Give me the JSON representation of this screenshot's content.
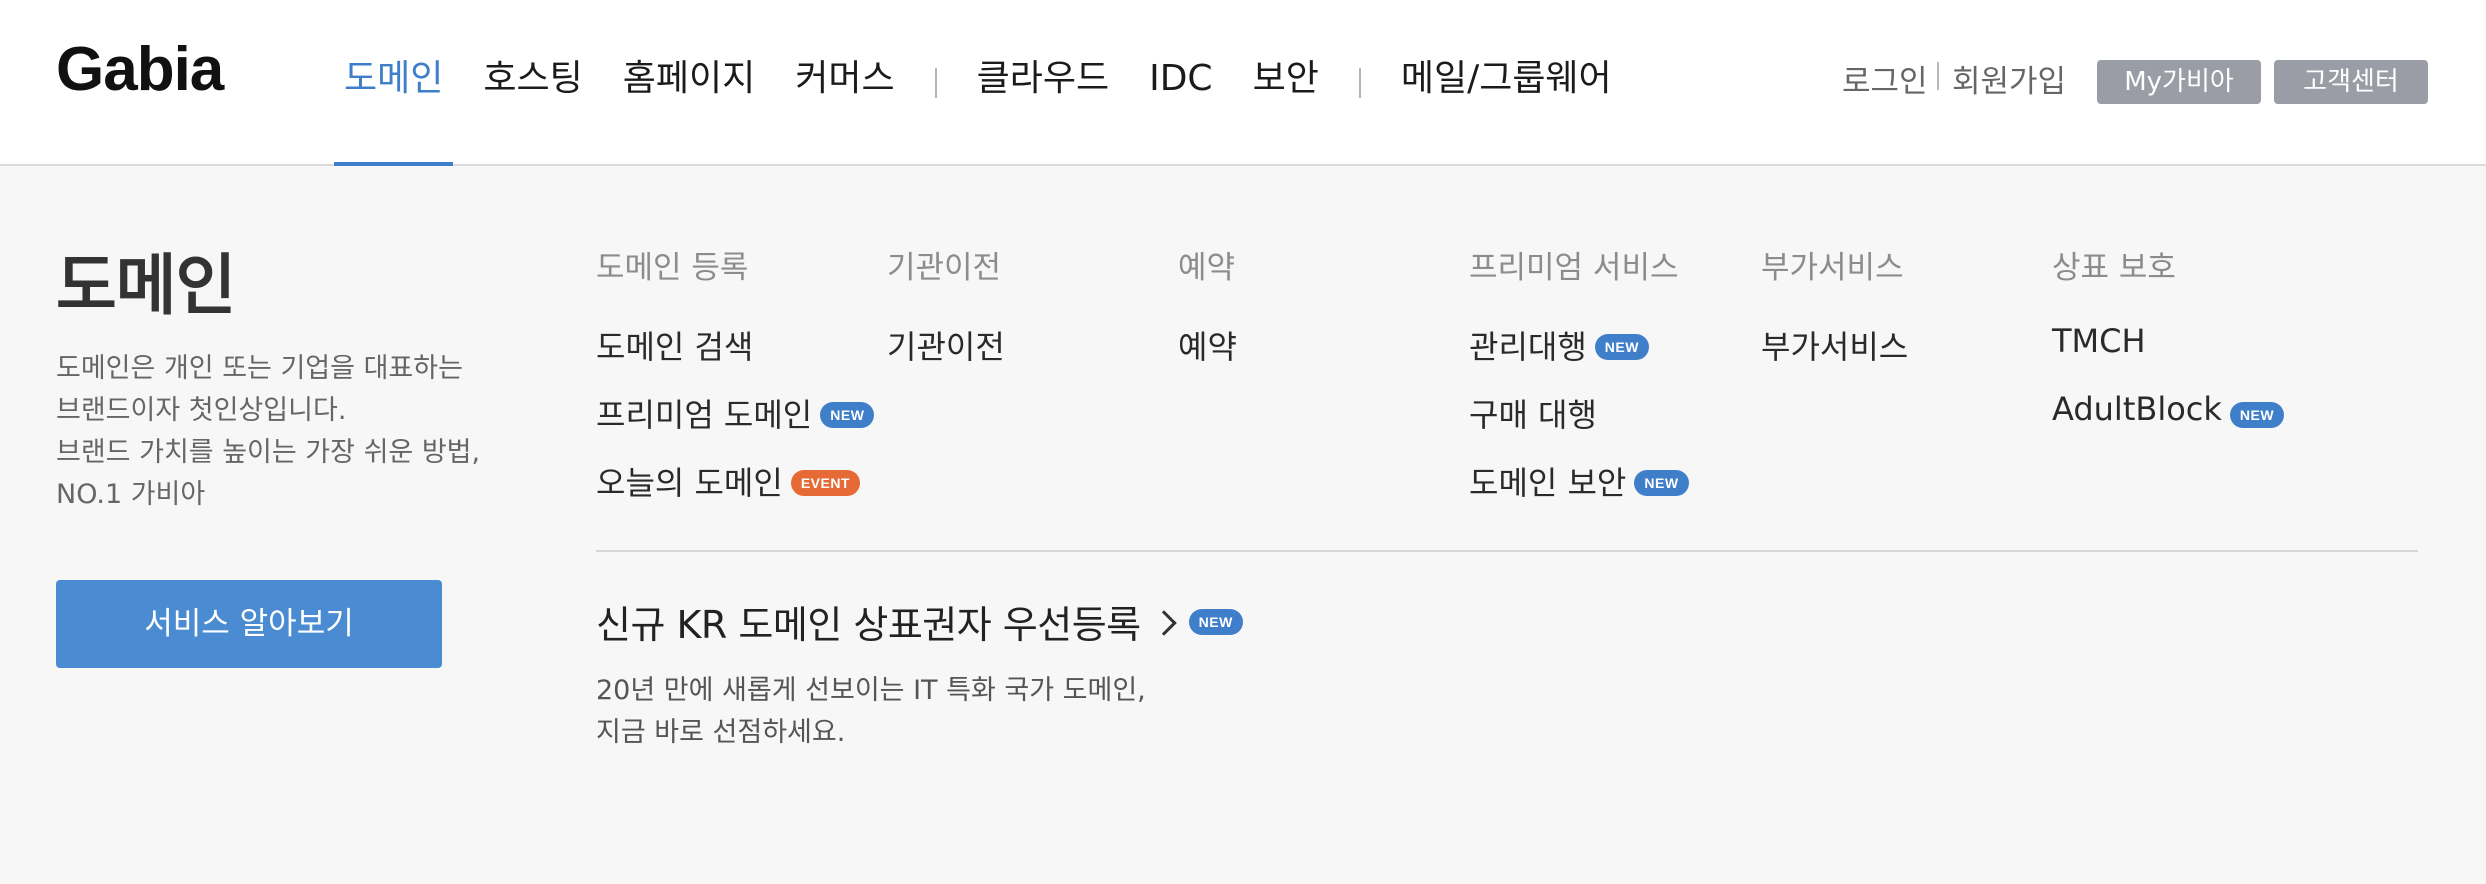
{
  "header": {
    "logo": "Gabia",
    "nav": [
      {
        "label": "도메인",
        "active": true
      },
      {
        "label": "호스팅"
      },
      {
        "label": "홈페이지"
      },
      {
        "label": "커머스"
      },
      {
        "label": "클라우드"
      },
      {
        "label": "IDC"
      },
      {
        "label": "보안"
      },
      {
        "label": "메일/그룹웨어"
      }
    ],
    "util": {
      "login": "로그인",
      "join": "회원가입",
      "my_button": "My가비아",
      "cs_button": "고객센터"
    }
  },
  "panel": {
    "title": "도메인",
    "desc_lines": [
      "도메인은 개인 또는 기업을 대표하는",
      "브랜드이자 첫인상입니다.",
      "브랜드 가치를 높이는 가장 쉬운 방법,",
      "NO.1 가비아"
    ],
    "cta": "서비스 알아보기",
    "columns": [
      {
        "heading": "도메인 등록",
        "items": [
          {
            "label": "도메인 검색",
            "badge": ""
          },
          {
            "label": "프리미엄 도메인",
            "badge": "NEW"
          },
          {
            "label": "오늘의 도메인",
            "badge": "EVENT"
          }
        ]
      },
      {
        "heading": "기관이전",
        "items": [
          {
            "label": "기관이전",
            "badge": ""
          }
        ]
      },
      {
        "heading": "예약",
        "items": [
          {
            "label": "예약",
            "badge": ""
          }
        ]
      },
      {
        "heading": "프리미엄 서비스",
        "items": [
          {
            "label": "관리대행",
            "badge": "NEW"
          },
          {
            "label": "구매 대행",
            "badge": ""
          },
          {
            "label": "도메인 보안",
            "badge": "NEW"
          }
        ]
      },
      {
        "heading": "부가서비스",
        "items": [
          {
            "label": "부가서비스",
            "badge": ""
          }
        ]
      },
      {
        "heading": "상표 보호",
        "items": [
          {
            "label": "TMCH",
            "badge": ""
          },
          {
            "label": "AdultBlock",
            "badge": "NEW"
          }
        ]
      }
    ],
    "promo": {
      "title": "신규 KR 도메인 상표권자 우선등록",
      "badge": "NEW",
      "desc_lines": [
        "20년 만에 새롭게 선보이는 IT 특화 국가 도메인,",
        "지금 바로 선점하세요."
      ]
    }
  },
  "colors": {
    "accent": "#3f7ec9",
    "cta": "#4a8bd2",
    "event": "#e56a36",
    "util_button": "#9a9da6",
    "panel_bg": "#f7f7f7"
  }
}
